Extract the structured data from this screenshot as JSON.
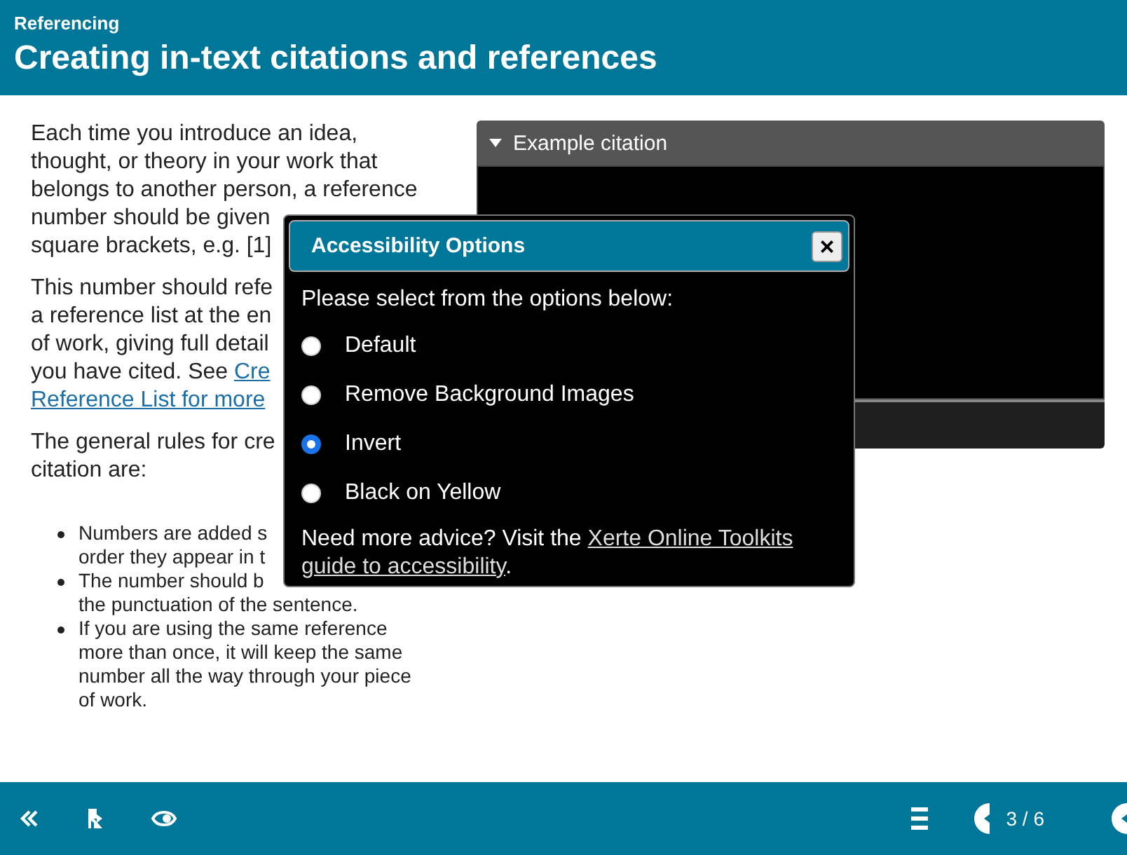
{
  "header": {
    "section": "Referencing",
    "title": "Creating in-text citations and references"
  },
  "body": {
    "paragraphs": [
      {
        "lines": [
          {
            "text": "Each time you introduce an idea,"
          },
          {
            "text": "thought, or theory in your work that"
          },
          {
            "text": "belongs to another person, a reference"
          },
          {
            "text": "number should be given"
          },
          {
            "text": "square brackets, e.g. [1]"
          }
        ]
      },
      {
        "lines": [
          {
            "text": "This number should refe"
          },
          {
            "text": "a reference list at the en"
          },
          {
            "text": "of work, giving full detail"
          },
          {
            "text": "you have cited. See ",
            "link": "Cre"
          },
          {
            "link": "Reference List for more"
          }
        ]
      },
      {
        "lines": [
          {
            "text": "The general rules for cre"
          },
          {
            "text": "citation are:"
          }
        ]
      }
    ],
    "bullets": [
      {
        "lines": [
          "Numbers are added s",
          "order they appear in t"
        ]
      },
      {
        "lines": [
          "The number should b",
          "the punctuation of the sentence."
        ]
      },
      {
        "lines": [
          "If you are using the same reference",
          "more than once, it will keep the same",
          "number all the way through your piece",
          "of work."
        ]
      }
    ]
  },
  "example_panel": {
    "title": "Example citation",
    "expanded": true
  },
  "dialog": {
    "title": "Accessibility Options",
    "close": "×",
    "prompt": "Please select from the options below:",
    "options": [
      {
        "label": "Default",
        "selected": false
      },
      {
        "label": "Remove Background Images",
        "selected": false
      },
      {
        "label": "Invert",
        "selected": true
      },
      {
        "label": "Black on Yellow",
        "selected": false
      }
    ],
    "advice": {
      "text": "Need more advice? Visit the ",
      "link_line_1": "Xerte Online Toolkits",
      "link_line_2": "guide to accessibility",
      "end": "."
    }
  },
  "footer": {
    "page": "3 / 6"
  }
}
